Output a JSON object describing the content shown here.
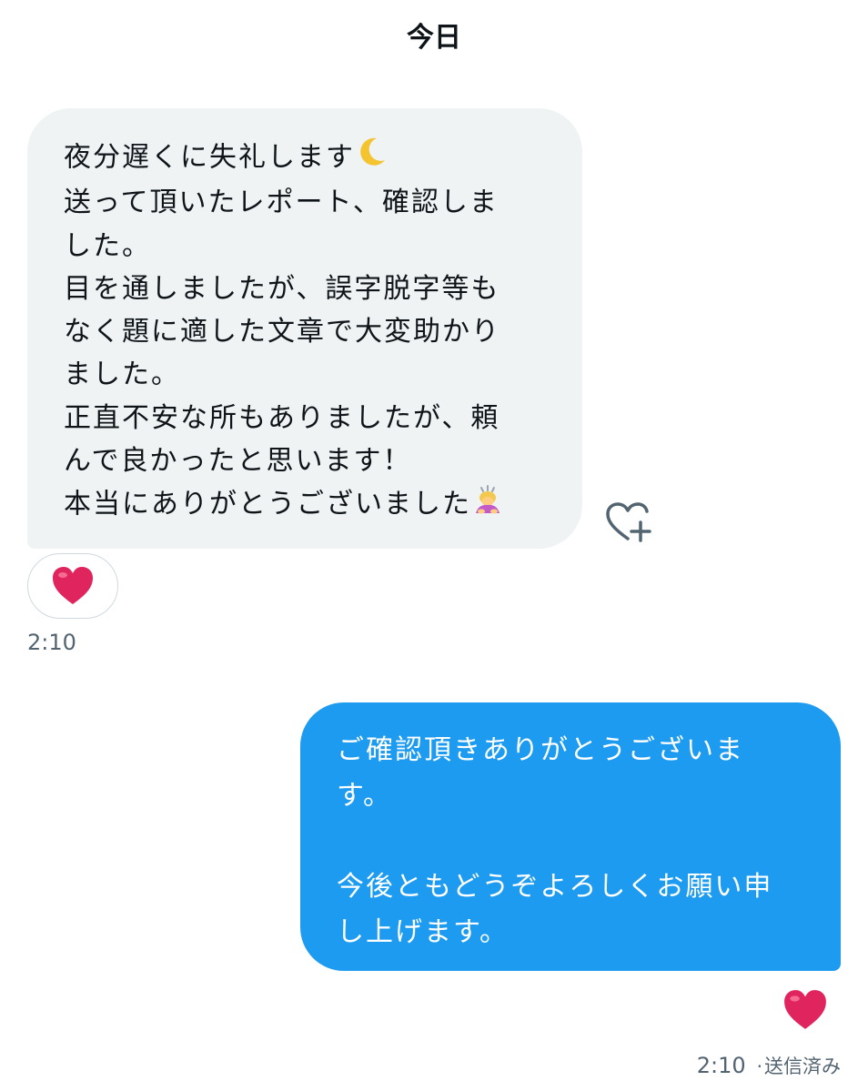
{
  "conversation": {
    "date_label": "今日"
  },
  "incoming": {
    "lines": [
      "夜分遅くに失礼します",
      "送って頂いたレポート、確認しま",
      "した。",
      "目を通しましたが、誤字脱字等も",
      "なく題に適した文章で大変助かり",
      "ました。",
      "正直不安な所もありましたが、頼",
      "んで良かったと思います！",
      "本当にありがとうございました"
    ],
    "emoji_line1": "crescent-moon-emoji",
    "emoji_last": "person-bowing-emoji",
    "reaction": "red-heart",
    "time": "2:10",
    "add_reaction_icon": "heart-plus-icon"
  },
  "outgoing": {
    "lines": [
      "ご確認頂きありがとうございま",
      "す。",
      "",
      "今後ともどうぞよろしくお願い申",
      "し上げます。"
    ],
    "reaction": "red-heart",
    "time": "2:10",
    "status": "送信済み",
    "separator": "·"
  },
  "colors": {
    "incoming_bubble": "#eff3f4",
    "outgoing_bubble": "#1d9bf0",
    "heart": "#e0245e",
    "meta_text": "#536471"
  }
}
